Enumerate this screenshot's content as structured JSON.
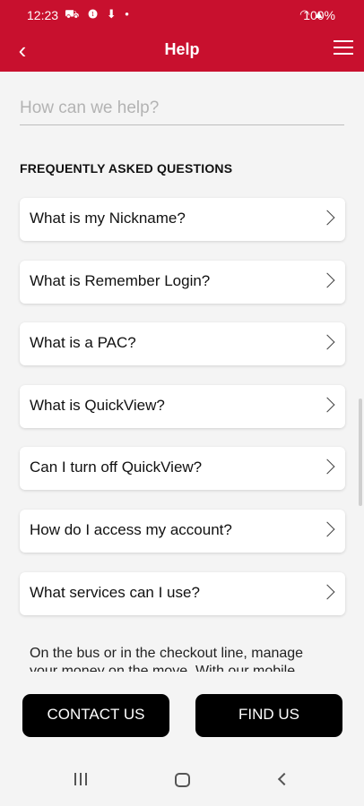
{
  "status_bar": {
    "time": "12:23",
    "left_icons": "⛟ ❶ ⬇ •",
    "right_icons": "◠ ▲",
    "battery": "100%"
  },
  "header": {
    "title": "Help"
  },
  "search": {
    "placeholder": "How can we help?",
    "value": ""
  },
  "faq": {
    "heading": "FREQUENTLY ASKED QUESTIONS",
    "items": [
      {
        "label": "What is my Nickname?"
      },
      {
        "label": "What is Remember Login?"
      },
      {
        "label": "What is a PAC?"
      },
      {
        "label": "What is QuickView?"
      },
      {
        "label": "Can I turn off QuickView?"
      },
      {
        "label": "How do I access my account?"
      },
      {
        "label": "What services can I use?"
      }
    ]
  },
  "promo": {
    "text": "On the bus or in the checkout line, manage your money on the move. With our mobile"
  },
  "buttons": {
    "contact": "CONTACT US",
    "find": "FIND US"
  },
  "colors": {
    "brand": "#c8102e",
    "button": "#000000"
  }
}
